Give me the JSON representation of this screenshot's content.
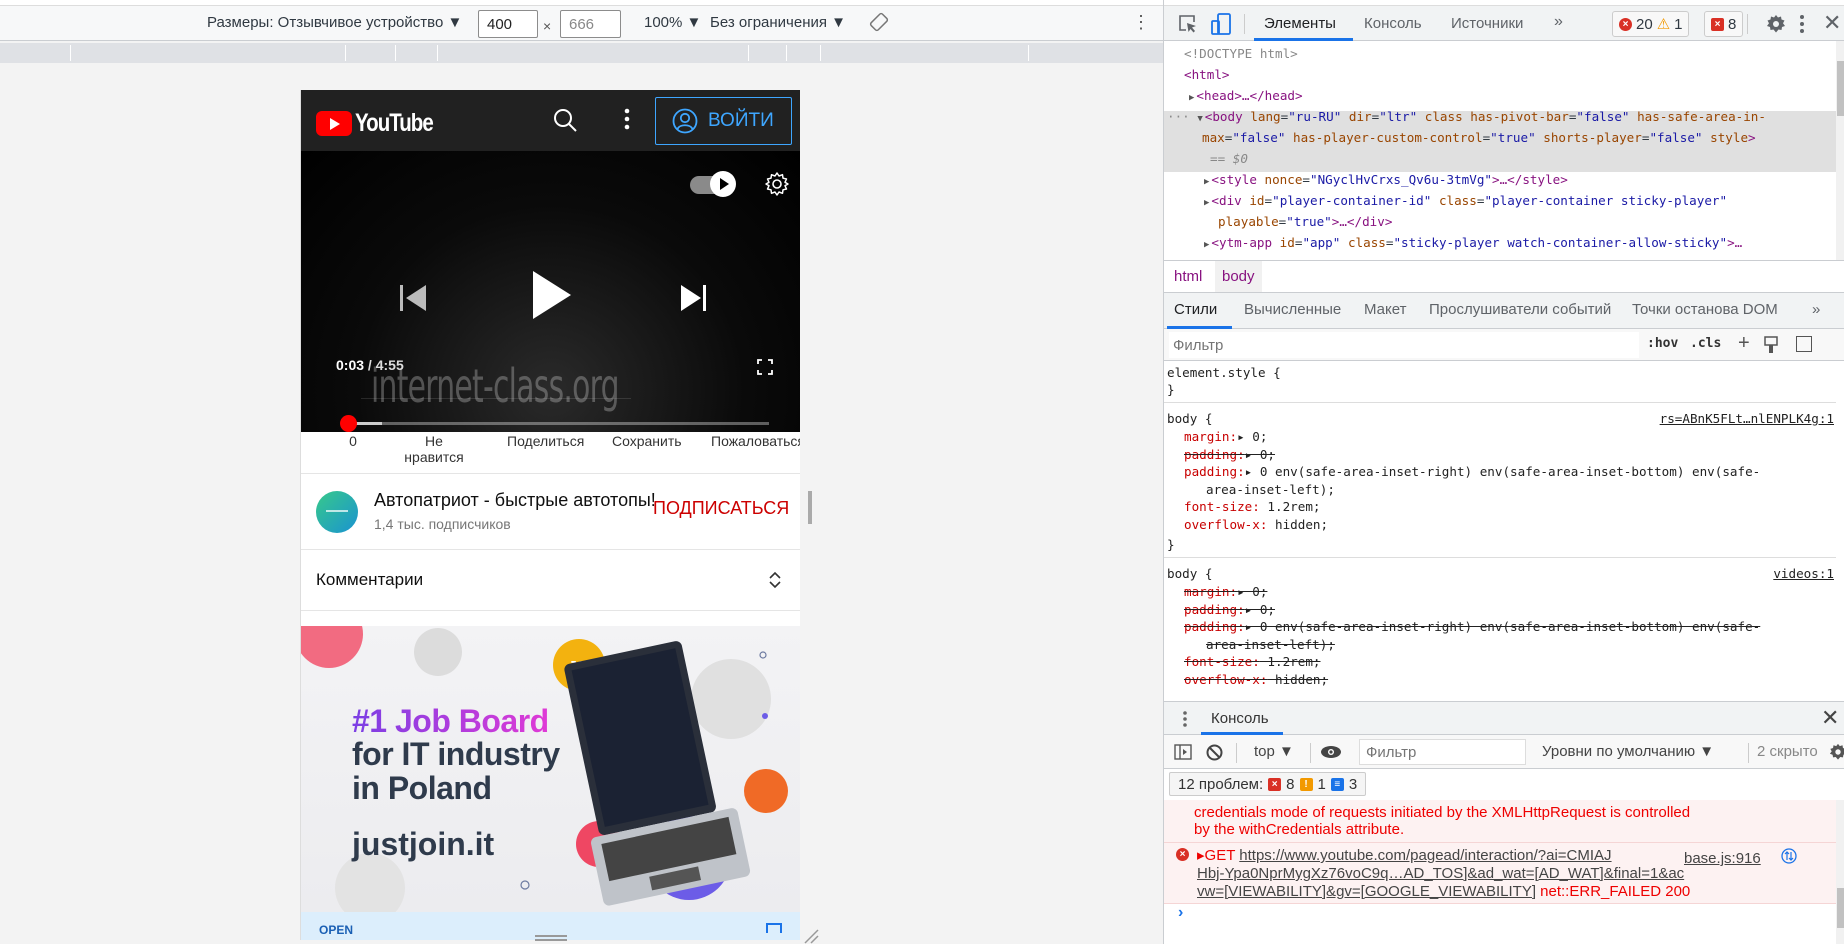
{
  "device_toolbar": {
    "dimensions_label": "Размеры: Отзывчивое устройство ▼",
    "width_value": "400",
    "height_value": "666",
    "times": "×",
    "zoom": "100% ▼",
    "throttling": "Без ограничения ▼"
  },
  "youtube": {
    "logo_text": "YouTube",
    "signin_label": "ВОЙТИ",
    "player": {
      "current_time": "0:03",
      "separator": " / ",
      "duration": "4:55",
      "watermark": "internet-class.org",
      "progress_fraction": 0.01,
      "buffered_fraction": 0.09,
      "autoplay": true
    },
    "actions": [
      "0",
      "Не нравится",
      "Поделиться",
      "Сохранить",
      "Пожаловаться"
    ],
    "channel": {
      "name": "Автопатриот - быстрые автотопы!",
      "subscribers": "1,4 тыс. подписчиков",
      "subscribe_label": "ПОДПИСАТЬСЯ"
    },
    "comments_label": "Комментарии",
    "ad": {
      "headline_1": "#1 Job Board",
      "headline_2": "for IT industry",
      "headline_3": "in Poland",
      "brand": "justjoin.it",
      "footer_label": "OPEN"
    }
  },
  "devtools": {
    "tabs": [
      "Элементы",
      "Консоль",
      "Источники"
    ],
    "more_tabs": "»",
    "badges": {
      "errors": "20",
      "warnings": "1",
      "issues": "8"
    },
    "dom": {
      "doctype": "<!DOCTYPE html>",
      "html_open": "<html>",
      "head": "<head>…</head>",
      "body_line1": {
        "tag": "<body",
        "attrs": [
          [
            "lang",
            "\"ru-RU\""
          ],
          [
            "dir",
            "\"ltr\""
          ],
          [
            "class",
            ""
          ],
          [
            "has-pivot-bar",
            "\"false\""
          ],
          [
            "has-safe-area-in-",
            ""
          ]
        ]
      },
      "body_line2": "max=\"false\" has-player-custom-control=\"true\" shorts-player=\"false\" style>",
      "body_ref": "== $0",
      "style_line": "<style nonce=\"NGyclHvCrxs_Qv6u-3tmVg\">…</style>",
      "div_line1": "<div id=\"player-container-id\" class=\"player-container sticky-player\"",
      "div_line2": "playable=\"true\">…</div>",
      "ytm_line": "<ytm-app id=\"app\" class=\"sticky-player watch-container-allow-sticky\">…"
    },
    "breadcrumbs": [
      "html",
      "body"
    ],
    "styles_tabs": [
      "Стили",
      "Вычисленные",
      "Макет",
      "Прослушиватели событий",
      "Точки останова DOM",
      "»"
    ],
    "filter_placeholder": "Фильтр",
    "hov": ":hov",
    "cls": ".cls",
    "rules": {
      "element_style": "element.style {",
      "close": "}",
      "body1": {
        "selector": "body {",
        "source": "rs=ABnK5FLt…nlENPLK4g:1",
        "decls": [
          {
            "prop": "margin",
            "val": "▸ 0;",
            "struck": false
          },
          {
            "prop": "padding",
            "val": "▸ 0;",
            "struck": true
          },
          {
            "prop": "padding",
            "val": "▸ 0 env(safe-area-inset-right) env(safe-area-inset-bottom) env(safe-",
            "struck": false
          },
          {
            "prop": "",
            "val": "area-inset-left);",
            "struck": false
          },
          {
            "prop": "font-size",
            "val": " 1.2rem;",
            "struck": false
          },
          {
            "prop": "overflow-x",
            "val": " hidden;",
            "struck": false
          }
        ]
      },
      "body2": {
        "selector": "body {",
        "source": "videos:1",
        "decls": [
          {
            "prop": "margin",
            "val": "▸ 0;",
            "struck": true
          },
          {
            "prop": "padding",
            "val": "▸ 0;",
            "struck": true
          },
          {
            "prop": "padding",
            "val": "▸ 0 env(safe-area-inset-right) env(safe-area-inset-bottom) env(safe-",
            "struck": true
          },
          {
            "prop": "",
            "val": "area-inset-left);",
            "struck": true
          },
          {
            "prop": "font-size",
            "val": " 1.2rem;",
            "struck": true
          },
          {
            "prop": "overflow-x",
            "val": " hidden;",
            "struck": true
          }
        ]
      }
    },
    "drawer": {
      "title": "Консоль",
      "context": "top ▼",
      "filter_placeholder": "Фильтр",
      "levels": "Уровни по умолчанию ▼",
      "hidden": "2 скрыто",
      "issues_label": "12 проблем:",
      "issues_errors": "8",
      "issues_warnings": "1",
      "issues_info": "3",
      "log": {
        "msg1_line1": "credentials mode of requests initiated by the XMLHttpRequest is controlled",
        "msg1_line2": "by the withCredentials attribute.",
        "msg2_method": "▸GET ",
        "msg2_url1": "https://www.youtube.com/pagead/interaction/?ai=CMIAJ",
        "msg2_url2": "Hbj-Ypa0NprMygXz76voC9q…AD_TOS]&ad_wat=[AD_WAT]&final=1&ac",
        "msg2_url3": "vw=[VIEWABILITY]&gv=[GOOGLE_VIEWABILITY]",
        "msg2_status": " net::ERR_FAILED 200",
        "msg2_source": "base.js:916"
      },
      "prompt": "›"
    }
  },
  "colors": {
    "youtube_red": "#ff0000",
    "signin_blue": "#3ea6ff",
    "subscribe_red": "#cc0000",
    "devtools_accent": "#1a73e8",
    "error_red": "#e00000"
  }
}
